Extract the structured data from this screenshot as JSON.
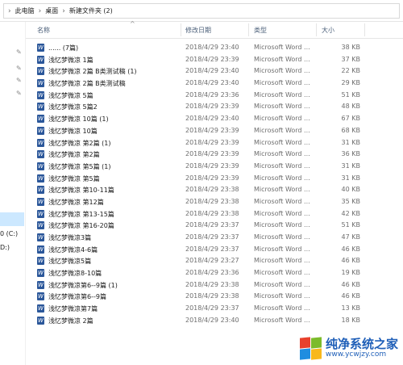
{
  "breadcrumb": [
    "此电脑",
    "桌面",
    "新建文件夹 (2)"
  ],
  "columns": {
    "name": "名称",
    "date": "修改日期",
    "type": "类型",
    "size": "大小"
  },
  "nav": {
    "drive_c": "0 (C:)",
    "drive_d": "D:)"
  },
  "files": [
    {
      "name": "...... (7篇)",
      "date": "2018/4/29 23:40",
      "type": "Microsoft Word ...",
      "size": "38 KB"
    },
    {
      "name": "浅忆梦微凉 1篇",
      "date": "2018/4/29 23:39",
      "type": "Microsoft Word ...",
      "size": "37 KB"
    },
    {
      "name": "浅忆梦微凉 2篇 B类测试稿 (1)",
      "date": "2018/4/29 23:40",
      "type": "Microsoft Word ...",
      "size": "22 KB"
    },
    {
      "name": "浅忆梦微凉 2篇 B类测试稿",
      "date": "2018/4/29 23:40",
      "type": "Microsoft Word ...",
      "size": "29 KB"
    },
    {
      "name": "浅忆梦微凉 5篇",
      "date": "2018/4/29 23:36",
      "type": "Microsoft Word ...",
      "size": "51 KB"
    },
    {
      "name": "浅忆梦微凉 5篇2",
      "date": "2018/4/29 23:39",
      "type": "Microsoft Word ...",
      "size": "48 KB"
    },
    {
      "name": "浅忆梦微凉 10篇 (1)",
      "date": "2018/4/29 23:40",
      "type": "Microsoft Word ...",
      "size": "67 KB"
    },
    {
      "name": "浅忆梦微凉 10篇",
      "date": "2018/4/29 23:39",
      "type": "Microsoft Word ...",
      "size": "68 KB"
    },
    {
      "name": "浅忆梦微凉 第2篇 (1)",
      "date": "2018/4/29 23:39",
      "type": "Microsoft Word ...",
      "size": "31 KB"
    },
    {
      "name": "浅忆梦微凉 第2篇",
      "date": "2018/4/29 23:39",
      "type": "Microsoft Word ...",
      "size": "36 KB"
    },
    {
      "name": "浅忆梦微凉 第5篇 (1)",
      "date": "2018/4/29 23:39",
      "type": "Microsoft Word ...",
      "size": "31 KB"
    },
    {
      "name": "浅忆梦微凉 第5篇",
      "date": "2018/4/29 23:39",
      "type": "Microsoft Word ...",
      "size": "31 KB"
    },
    {
      "name": "浅忆梦微凉 第10-11篇",
      "date": "2018/4/29 23:38",
      "type": "Microsoft Word ...",
      "size": "40 KB"
    },
    {
      "name": "浅忆梦微凉 第12篇",
      "date": "2018/4/29 23:38",
      "type": "Microsoft Word ...",
      "size": "35 KB"
    },
    {
      "name": "浅忆梦微凉 第13-15篇",
      "date": "2018/4/29 23:38",
      "type": "Microsoft Word ...",
      "size": "42 KB"
    },
    {
      "name": "浅忆梦微凉 第16-20篇",
      "date": "2018/4/29 23:37",
      "type": "Microsoft Word ...",
      "size": "51 KB"
    },
    {
      "name": "浅忆梦微凉3篇",
      "date": "2018/4/29 23:37",
      "type": "Microsoft Word ...",
      "size": "47 KB"
    },
    {
      "name": "浅忆梦微凉4-6篇",
      "date": "2018/4/29 23:37",
      "type": "Microsoft Word ...",
      "size": "46 KB"
    },
    {
      "name": "浅忆梦微凉5篇",
      "date": "2018/4/29 23:27",
      "type": "Microsoft Word ...",
      "size": "46 KB"
    },
    {
      "name": "浅忆梦微凉8-10篇",
      "date": "2018/4/29 23:36",
      "type": "Microsoft Word ...",
      "size": "19 KB"
    },
    {
      "name": "浅忆梦微凉第6--9篇 (1)",
      "date": "2018/4/29 23:38",
      "type": "Microsoft Word ...",
      "size": "46 KB"
    },
    {
      "name": "浅忆梦微凉第6--9篇",
      "date": "2018/4/29 23:38",
      "type": "Microsoft Word ...",
      "size": "46 KB"
    },
    {
      "name": "浅忆梦微凉第7篇",
      "date": "2018/4/29 23:37",
      "type": "Microsoft Word ...",
      "size": "13 KB"
    },
    {
      "name": "浅忆梦微凉 2篇",
      "date": "2018/4/29 23:40",
      "type": "Microsoft Word ...",
      "size": "18 KB"
    }
  ],
  "watermark": {
    "title": "纯净系统之家",
    "url": "www.ycwjzy.com"
  },
  "colors": {
    "accent": "#2b579a",
    "selection": "#cce8ff",
    "header_text": "#4c607a"
  }
}
